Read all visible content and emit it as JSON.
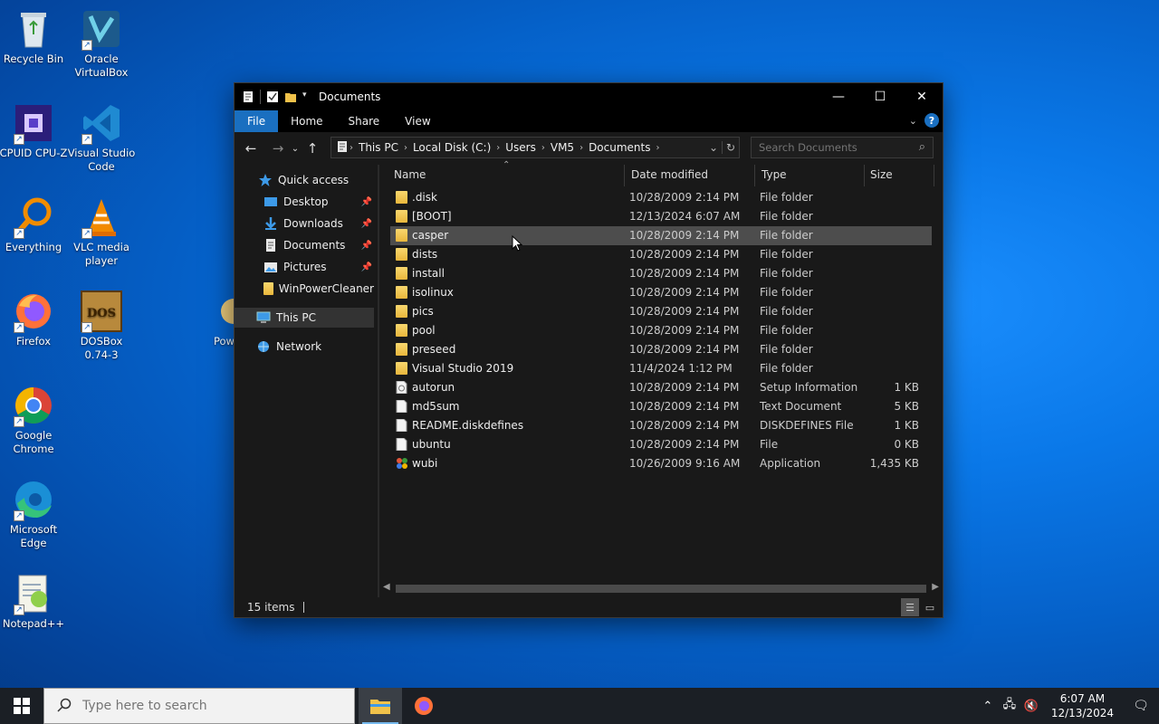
{
  "desktop_icons": [
    {
      "label": "Recycle Bin",
      "icon": "recycle-bin-icon"
    },
    {
      "label": "Oracle VirtualBox",
      "icon": "virtualbox-icon"
    },
    {
      "label": "CPUID CPU-Z",
      "icon": "cpuz-icon"
    },
    {
      "label": "Visual Studio Code",
      "icon": "vscode-icon"
    },
    {
      "label": "Everything",
      "icon": "everything-icon"
    },
    {
      "label": "VLC media player",
      "icon": "vlc-icon"
    },
    {
      "label": "Firefox",
      "icon": "firefox-icon"
    },
    {
      "label": "DOSBox 0.74-3",
      "icon": "dosbox-icon"
    },
    {
      "label": "Pow",
      "icon": "powershell-icon"
    },
    {
      "label": "Google Chrome",
      "icon": "chrome-icon"
    },
    {
      "label": "Microsoft Edge",
      "icon": "edge-icon"
    },
    {
      "label": "Notepad++",
      "icon": "notepadpp-icon"
    }
  ],
  "window": {
    "title": "Documents",
    "ribbon_tabs": [
      "File",
      "Home",
      "Share",
      "View"
    ],
    "breadcrumb": [
      "This PC",
      "Local Disk (C:)",
      "Users",
      "VM5",
      "Documents"
    ],
    "search_placeholder": "Search Documents",
    "nav": {
      "quick_access": "Quick access",
      "items": [
        "Desktop",
        "Downloads",
        "Documents",
        "Pictures",
        "WinPowerCleaner"
      ],
      "this_pc": "This PC",
      "network": "Network"
    },
    "columns": {
      "name": "Name",
      "date": "Date modified",
      "type": "Type",
      "size": "Size"
    },
    "files": [
      {
        "name": ".disk",
        "date": "10/28/2009 2:14 PM",
        "type": "File folder",
        "size": "",
        "icon": "folder"
      },
      {
        "name": "[BOOT]",
        "date": "12/13/2024 6:07 AM",
        "type": "File folder",
        "size": "",
        "icon": "folder"
      },
      {
        "name": "casper",
        "date": "10/28/2009 2:14 PM",
        "type": "File folder",
        "size": "",
        "icon": "folder"
      },
      {
        "name": "dists",
        "date": "10/28/2009 2:14 PM",
        "type": "File folder",
        "size": "",
        "icon": "folder"
      },
      {
        "name": "install",
        "date": "10/28/2009 2:14 PM",
        "type": "File folder",
        "size": "",
        "icon": "folder"
      },
      {
        "name": "isolinux",
        "date": "10/28/2009 2:14 PM",
        "type": "File folder",
        "size": "",
        "icon": "folder"
      },
      {
        "name": "pics",
        "date": "10/28/2009 2:14 PM",
        "type": "File folder",
        "size": "",
        "icon": "folder"
      },
      {
        "name": "pool",
        "date": "10/28/2009 2:14 PM",
        "type": "File folder",
        "size": "",
        "icon": "folder"
      },
      {
        "name": "preseed",
        "date": "10/28/2009 2:14 PM",
        "type": "File folder",
        "size": "",
        "icon": "folder"
      },
      {
        "name": "Visual Studio 2019",
        "date": "11/4/2024 1:12 PM",
        "type": "File folder",
        "size": "",
        "icon": "folder"
      },
      {
        "name": "autorun",
        "date": "10/28/2009 2:14 PM",
        "type": "Setup Information",
        "size": "1 KB",
        "icon": "setup"
      },
      {
        "name": "md5sum",
        "date": "10/28/2009 2:14 PM",
        "type": "Text Document",
        "size": "5 KB",
        "icon": "doc"
      },
      {
        "name": "README.diskdefines",
        "date": "10/28/2009 2:14 PM",
        "type": "DISKDEFINES File",
        "size": "1 KB",
        "icon": "doc"
      },
      {
        "name": "ubuntu",
        "date": "10/28/2009 2:14 PM",
        "type": "File",
        "size": "0 KB",
        "icon": "doc"
      },
      {
        "name": "wubi",
        "date": "10/26/2009 9:16 AM",
        "type": "Application",
        "size": "1,435 KB",
        "icon": "app"
      }
    ],
    "status": "15 items"
  },
  "taskbar": {
    "search_placeholder": "Type here to search",
    "time": "6:07 AM",
    "date": "12/13/2024"
  },
  "colors": {
    "accent": "#1a6fc0",
    "folder": "#e9b73c",
    "window_bg": "#191919"
  }
}
